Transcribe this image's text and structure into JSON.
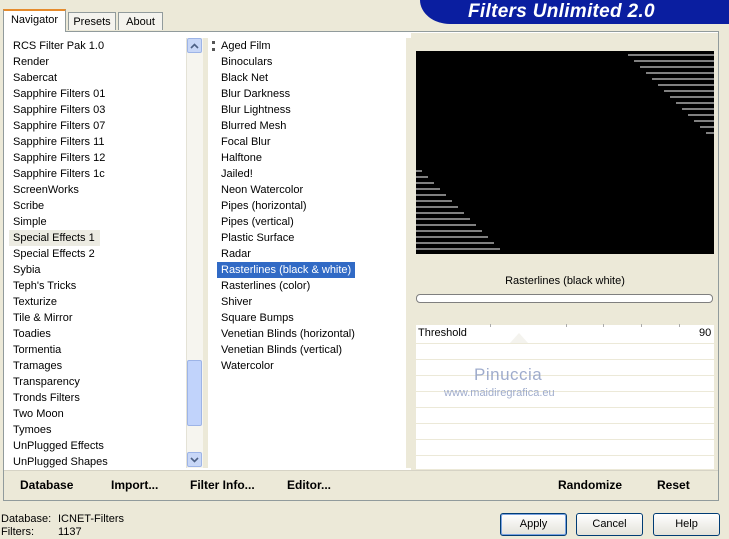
{
  "app": {
    "title": "Filters Unlimited 2.0"
  },
  "tabs": [
    {
      "label": "Navigator"
    },
    {
      "label": "Presets"
    },
    {
      "label": "About"
    }
  ],
  "categories": [
    "RCS Filter Pak 1.0",
    "Render",
    "Sabercat",
    "Sapphire Filters 01",
    "Sapphire Filters 03",
    "Sapphire Filters 07",
    "Sapphire Filters 11",
    "Sapphire Filters 12",
    "Sapphire Filters 1c",
    "ScreenWorks",
    "Scribe",
    "Simple",
    "Special Effects 1",
    "Special Effects 2",
    "Sybia",
    "Teph's Tricks",
    "Texturize",
    "Tile & Mirror",
    "Toadies",
    "Tormentia",
    "Tramages",
    "Transparency",
    "Tronds Filters",
    "Two Moon",
    "Tymoes",
    "UnPlugged Effects",
    "UnPlugged Shapes"
  ],
  "filters": [
    "Aged Film",
    "Binoculars",
    "Black Net",
    "Blur Darkness",
    "Blur Lightness",
    "Blurred Mesh",
    "Focal Blur",
    "Halftone",
    "Jailed!",
    "Neon Watercolor",
    "Pipes (horizontal)",
    "Pipes (vertical)",
    "Plastic Surface",
    "Radar",
    "Rasterlines (black & white)",
    "Rasterlines (color)",
    "Shiver",
    "Square Bumps",
    "Venetian Blinds (horizontal)",
    "Venetian Blinds (vertical)",
    "Watercolor"
  ],
  "selected_category": "Special Effects 1",
  "selected_filter": "Rasterlines (black & white)",
  "preview": {
    "filter_name": "Rasterlines (black  white)"
  },
  "params": {
    "threshold_label": "Threshold",
    "threshold_value": "90"
  },
  "watermark": {
    "line1": "Pinuccia",
    "line2": "www.maidiregrafica.eu"
  },
  "toolbar": {
    "database": "Database",
    "import": "Import...",
    "filter_info": "Filter Info...",
    "editor": "Editor...",
    "randomize": "Randomize",
    "reset": "Reset"
  },
  "status": {
    "database_label": "Database:",
    "database_value": "ICNET-Filters",
    "filters_label": "Filters:",
    "filters_value": "1137"
  },
  "buttons": {
    "apply": "Apply",
    "cancel": "Cancel",
    "help": "Help"
  }
}
